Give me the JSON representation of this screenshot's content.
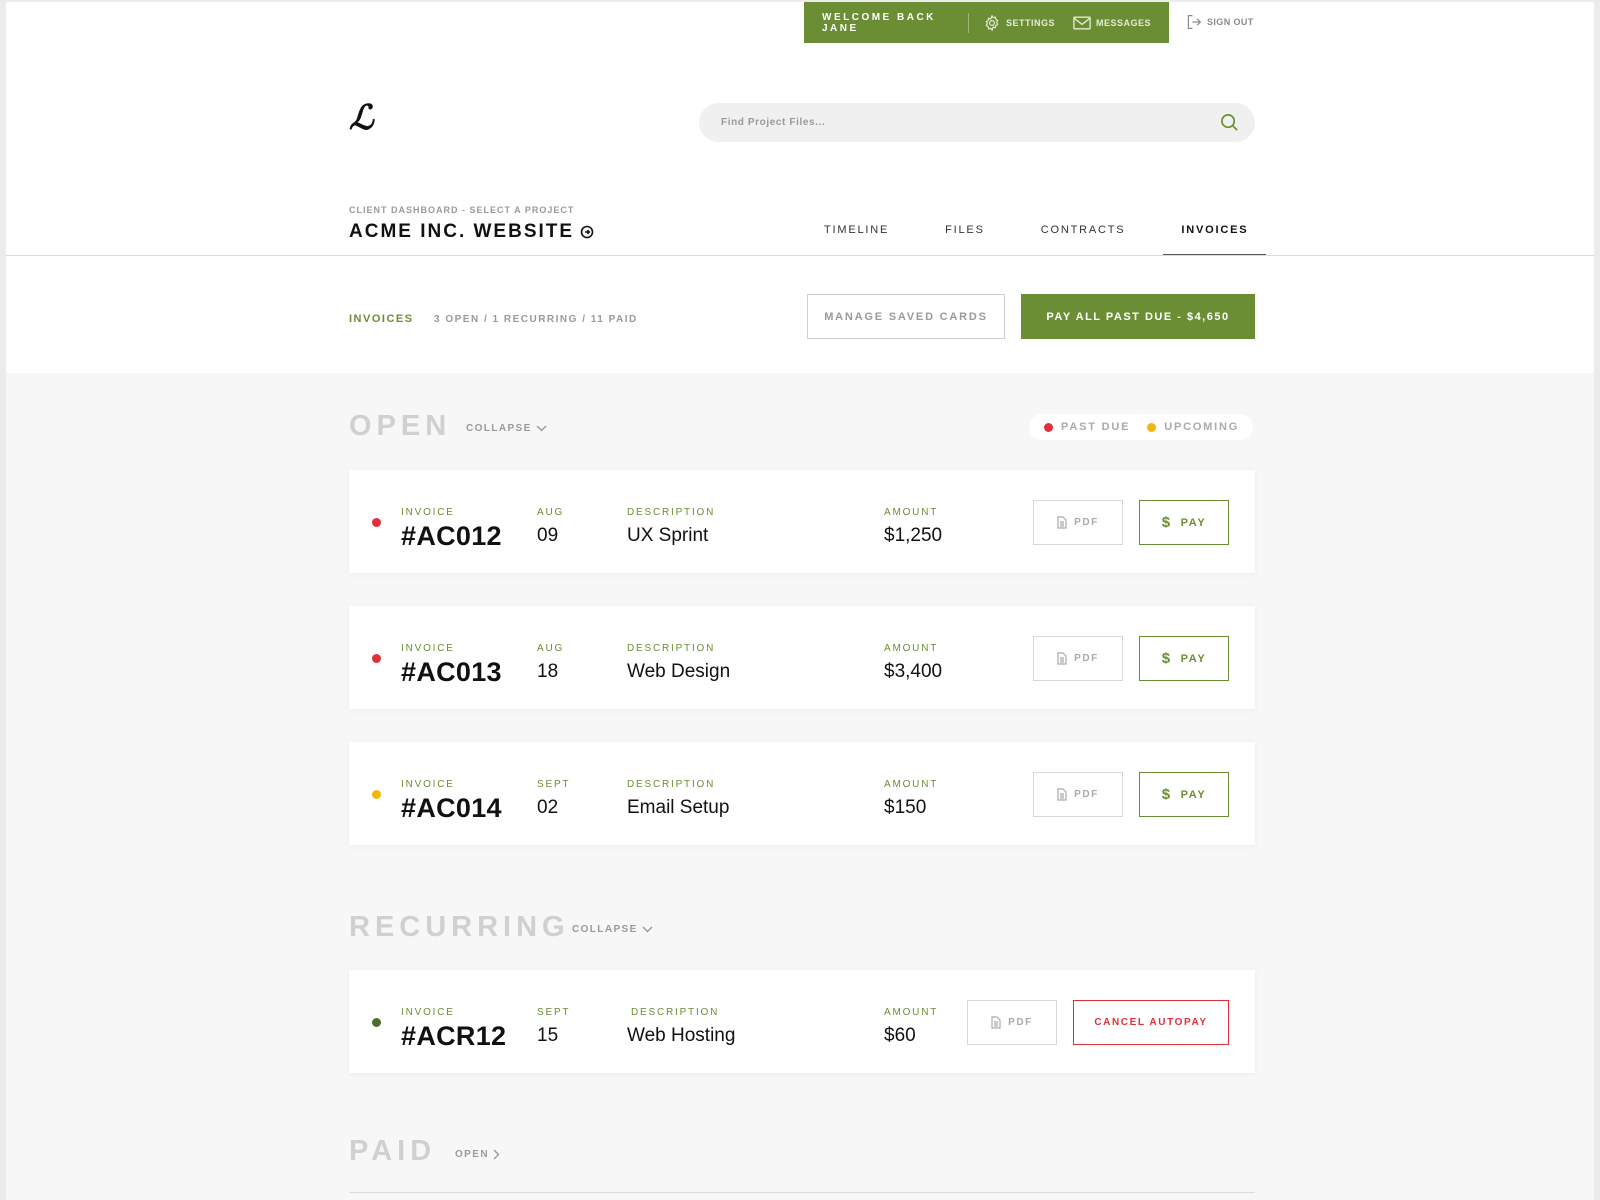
{
  "colors": {
    "accent": "#6b8e35",
    "past_due": "#e0303a",
    "upcoming": "#f5b60b",
    "recurring": "#4f6e2d"
  },
  "topbar": {
    "welcome": "WELCOME BACK JANE",
    "settings": "SETTINGS",
    "messages": "MESSAGES",
    "signout": "SIGN OUT"
  },
  "header": {
    "logo": "ℒ",
    "search_placeholder": "Find Project Files..."
  },
  "project": {
    "breadcrumb": "CLIENT DASHBOARD - SELECT A PROJECT",
    "title": "ACME INC. WEBSITE"
  },
  "tabs": [
    {
      "label": "TIMELINE"
    },
    {
      "label": "FILES"
    },
    {
      "label": "CONTRACTS"
    },
    {
      "label": "INVOICES",
      "active": true
    }
  ],
  "invoices_bar": {
    "label": "INVOICES",
    "counts": "3 OPEN / 1 RECURRING / 11 PAID",
    "manage_cards": "MANAGE SAVED CARDS",
    "pay_all": "PAY ALL PAST DUE - $4,650"
  },
  "legend": {
    "past_due": "PAST DUE",
    "upcoming": "UPCOMING"
  },
  "labels": {
    "invoice": "INVOICE",
    "description": "DESCRIPTION",
    "amount": "AMOUNT",
    "pdf": "PDF",
    "pay": "PAY",
    "cancel_autopay": "CANCEL AUTOPAY"
  },
  "sections": {
    "open": {
      "title": "OPEN",
      "toggle": "COLLAPSE",
      "invoices": [
        {
          "status": "past_due",
          "number": "#AC012",
          "month": "AUG",
          "day": "09",
          "description": "UX Sprint",
          "amount": "$1,250"
        },
        {
          "status": "past_due",
          "number": "#AC013",
          "month": "AUG",
          "day": "18",
          "description": "Web Design",
          "amount": "$3,400"
        },
        {
          "status": "upcoming",
          "number": "#AC014",
          "month": "SEPT",
          "day": "02",
          "description": "Email Setup",
          "amount": "$150"
        }
      ]
    },
    "recurring": {
      "title": "RECURRING",
      "toggle": "COLLAPSE",
      "invoices": [
        {
          "status": "recurring",
          "number": "#ACR12",
          "month": "SEPT",
          "day": "15",
          "description": "Web Hosting",
          "amount": "$60"
        }
      ]
    },
    "paid": {
      "title": "PAID",
      "toggle": "OPEN"
    }
  }
}
